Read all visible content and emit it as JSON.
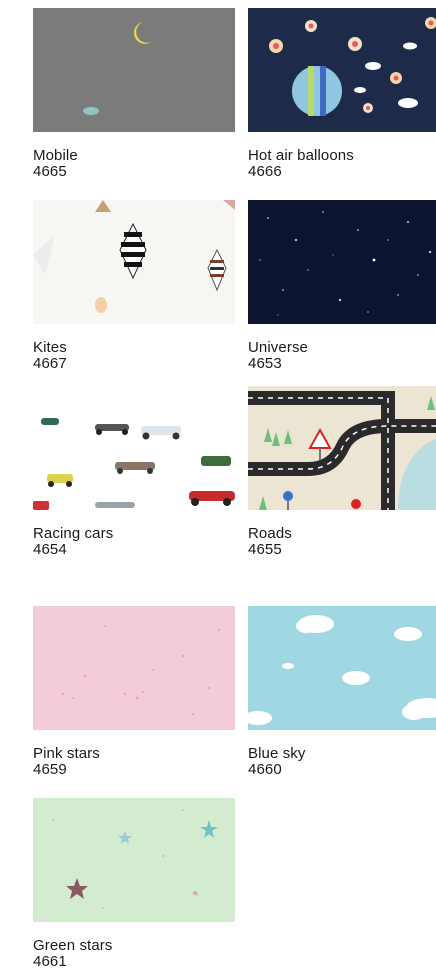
{
  "items": [
    {
      "name": "Mobile",
      "code": "4665"
    },
    {
      "name": "Hot air balloons",
      "code": "4666"
    },
    {
      "name": "Kites",
      "code": "4667"
    },
    {
      "name": "Universe",
      "code": "4653"
    },
    {
      "name": "Racing cars",
      "code": "4654"
    },
    {
      "name": "Roads",
      "code": "4655"
    },
    {
      "name": "Pink stars",
      "code": "4659"
    },
    {
      "name": "Blue sky",
      "code": "4660"
    },
    {
      "name": "Green stars",
      "code": "4661"
    }
  ]
}
